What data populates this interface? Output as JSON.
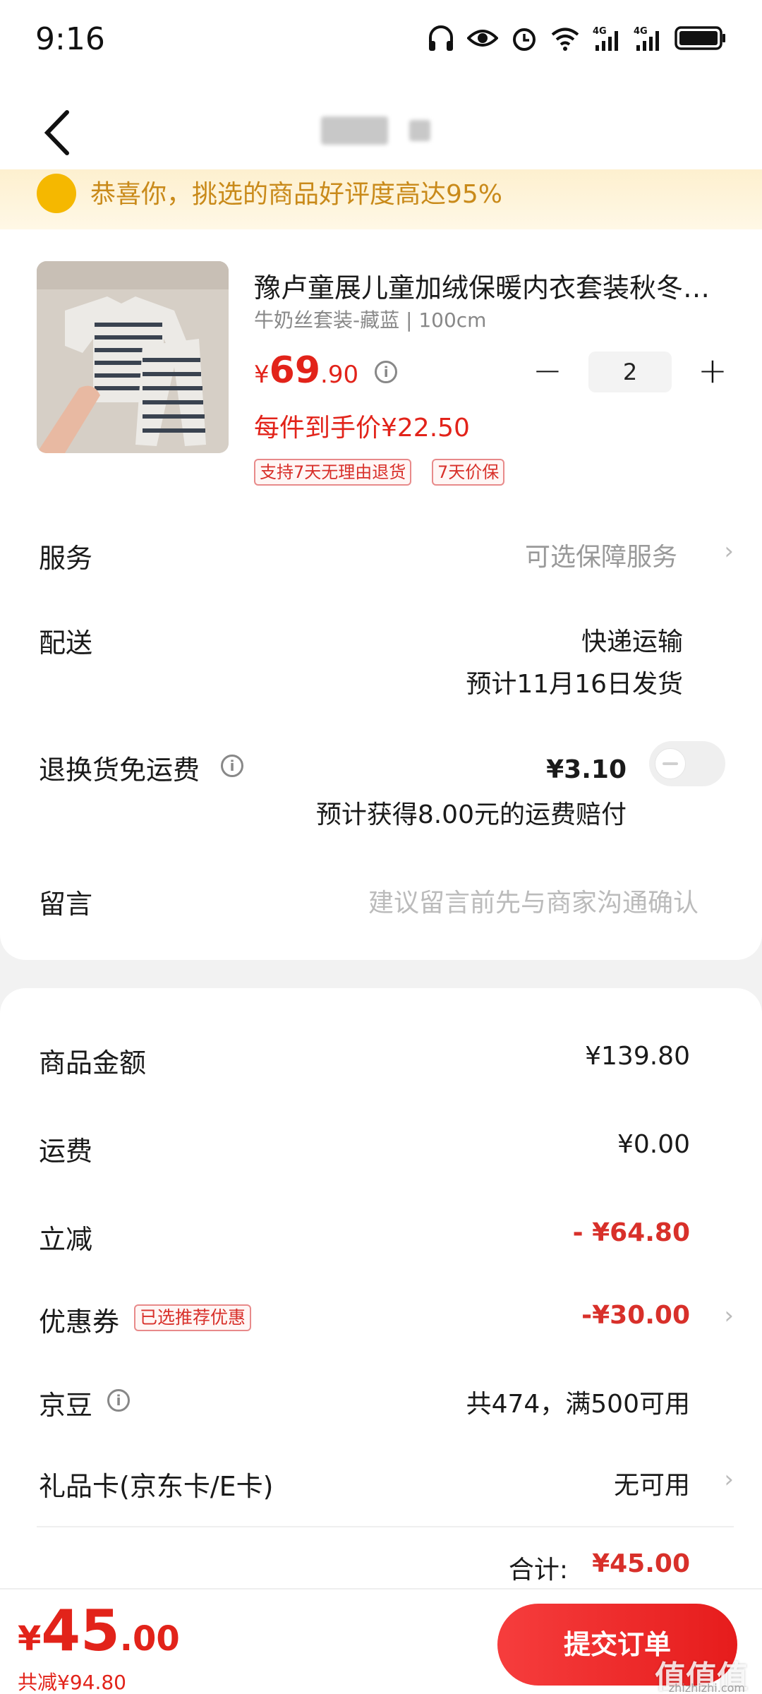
{
  "status_bar": {
    "time": "9:16",
    "icons": [
      "headphones-icon",
      "eye-icon",
      "alarm-icon",
      "wifi-icon",
      "signal-4g-icon",
      "signal-4g-icon",
      "battery-icon"
    ]
  },
  "nav": {
    "back_icon": "chevron-left-icon"
  },
  "banner": {
    "text": "恭喜你，挑选的商品好评度高达95%"
  },
  "product": {
    "title": "豫卢童展儿童加绒保暖内衣套装秋冬…",
    "spec": "牛奶丝套装-藏蓝 | 100cm",
    "price_symbol": "¥",
    "price_int": "69",
    "price_dec": ".90",
    "unit_price": "每件到手价¥22.50",
    "tags": [
      "支持7天无理由退货",
      "7天价保"
    ],
    "quantity": "2",
    "minus": "−",
    "plus": "+"
  },
  "rows": {
    "service_label": "服务",
    "service_value": "可选保障服务",
    "delivery_label": "配送",
    "delivery_method": "快递运输",
    "delivery_eta": "预计11月16日发货",
    "return_label": "退换货免运费",
    "return_price": "¥3.10",
    "return_note": "预计获得8.00元的运费赔付",
    "message_label": "留言",
    "message_placeholder": "建议留言前先与商家沟通确认"
  },
  "summary": {
    "goods_label": "商品金额",
    "goods_value": "¥139.80",
    "shipping_label": "运费",
    "shipping_value": "¥0.00",
    "discount_label": "立减",
    "discount_value": "- ¥64.80",
    "coupon_label": "优惠券",
    "coupon_tag": "已选推荐优惠",
    "coupon_value": "-¥30.00",
    "beans_label": "京豆",
    "beans_value": "共474，满500可用",
    "giftcard_label": "礼品卡(京东卡/E卡)",
    "giftcard_value": "无可用",
    "total_label": "合计:",
    "total_value": "¥45.00"
  },
  "bottom": {
    "symbol": "¥",
    "int": "45",
    "dec": ".00",
    "saved": "共减¥94.80",
    "submit": "提交订单"
  },
  "watermark": {
    "text": "值值值",
    "sub": "zhizhizhi.com"
  },
  "colors": {
    "accent_red": "#e2231a",
    "banner_bg": "#fdf0cf",
    "banner_text": "#c98a1a"
  }
}
